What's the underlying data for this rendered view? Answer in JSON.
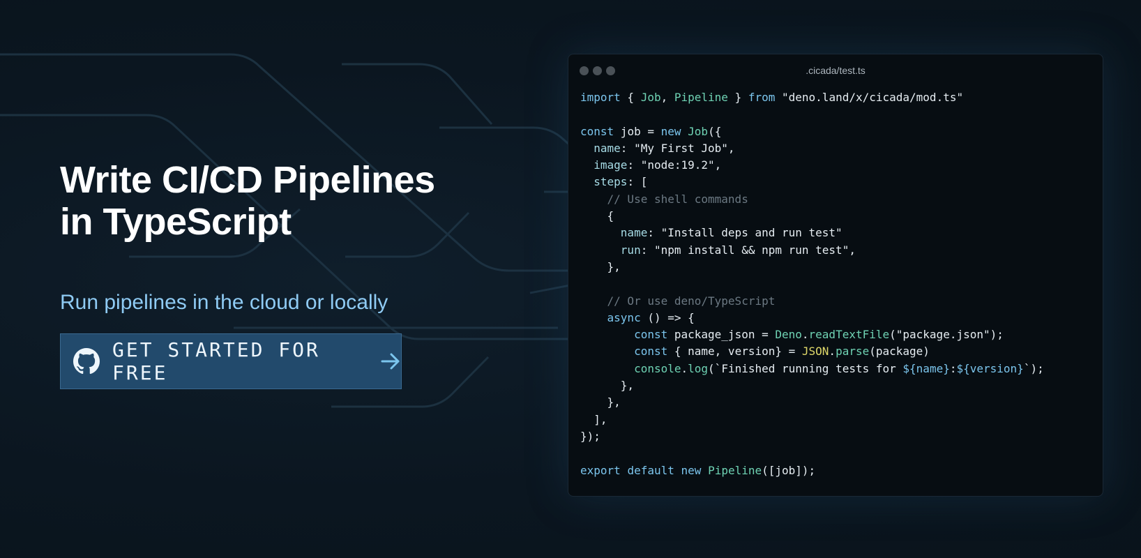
{
  "hero": {
    "title_line1": "Write CI/CD Pipelines",
    "title_line2": "in TypeScript",
    "subtitle": "Run pipelines in the cloud or locally",
    "cta_label": "GET STARTED FOR FREE",
    "cta_icon": "github-icon",
    "cta_arrow_icon": "arrow-right-icon"
  },
  "editor": {
    "filename": ".cicada/test.ts",
    "code_lines": [
      [
        [
          "k",
          "import"
        ],
        [
          "s",
          " { "
        ],
        [
          "t",
          "Job"
        ],
        [
          "s",
          ", "
        ],
        [
          "t",
          "Pipeline"
        ],
        [
          "s",
          " } "
        ],
        [
          "k",
          "from"
        ],
        [
          "s",
          " \"deno.land/x/cicada/mod.ts\""
        ]
      ],
      [],
      [
        [
          "k",
          "const"
        ],
        [
          "s",
          " job = "
        ],
        [
          "k",
          "new"
        ],
        [
          "s",
          " "
        ],
        [
          "t",
          "Job"
        ],
        [
          "s",
          "({"
        ]
      ],
      [
        [
          "s",
          "  "
        ],
        [
          "p",
          "name"
        ],
        [
          "s",
          ": \"My First Job\","
        ]
      ],
      [
        [
          "s",
          "  "
        ],
        [
          "p",
          "image"
        ],
        [
          "s",
          ": \"node:19.2\","
        ]
      ],
      [
        [
          "s",
          "  "
        ],
        [
          "p",
          "steps"
        ],
        [
          "s",
          ": ["
        ]
      ],
      [
        [
          "c",
          "    // Use shell commands"
        ]
      ],
      [
        [
          "s",
          "    {"
        ]
      ],
      [
        [
          "s",
          "      "
        ],
        [
          "p",
          "name"
        ],
        [
          "s",
          ": \"Install deps and run test\""
        ]
      ],
      [
        [
          "s",
          "      "
        ],
        [
          "p",
          "run"
        ],
        [
          "s",
          ": \"npm install && npm run test\","
        ]
      ],
      [
        [
          "s",
          "    },"
        ]
      ],
      [],
      [
        [
          "c",
          "    // Or use deno/TypeScript"
        ]
      ],
      [
        [
          "s",
          "    "
        ],
        [
          "k",
          "async"
        ],
        [
          "s",
          " () => {"
        ]
      ],
      [
        [
          "s",
          "        "
        ],
        [
          "k",
          "const"
        ],
        [
          "s",
          " package_json = "
        ],
        [
          "t",
          "Deno"
        ],
        [
          "s",
          "."
        ],
        [
          "f",
          "readTextFile"
        ],
        [
          "s",
          "(\"package.json\");"
        ]
      ],
      [
        [
          "s",
          "        "
        ],
        [
          "k",
          "const"
        ],
        [
          "s",
          " { name, version} = "
        ],
        [
          "j",
          "JSON"
        ],
        [
          "s",
          "."
        ],
        [
          "f",
          "parse"
        ],
        [
          "s",
          "(package)"
        ]
      ],
      [
        [
          "s",
          "        "
        ],
        [
          "f",
          "console"
        ],
        [
          "s",
          "."
        ],
        [
          "f",
          "log"
        ],
        [
          "s",
          "(`Finished running tests for "
        ],
        [
          "i",
          "${name}"
        ],
        [
          "s",
          ":"
        ],
        [
          "i",
          "${version}"
        ],
        [
          "s",
          "`);"
        ]
      ],
      [
        [
          "s",
          "      },"
        ]
      ],
      [
        [
          "s",
          "    },"
        ]
      ],
      [
        [
          "s",
          "  ],"
        ]
      ],
      [
        [
          "s",
          "});"
        ]
      ],
      [],
      [
        [
          "k",
          "export"
        ],
        [
          "s",
          " "
        ],
        [
          "k",
          "default"
        ],
        [
          "s",
          " "
        ],
        [
          "k",
          "new"
        ],
        [
          "s",
          " "
        ],
        [
          "t",
          "Pipeline"
        ],
        [
          "s",
          "([job]);"
        ]
      ]
    ]
  },
  "colors": {
    "background": "#0b1620",
    "button": "#224a6c",
    "subtitle": "#8fcbf4",
    "keyword": "#7cc6ee",
    "type": "#6fd3b4",
    "comment": "#6c7983"
  }
}
